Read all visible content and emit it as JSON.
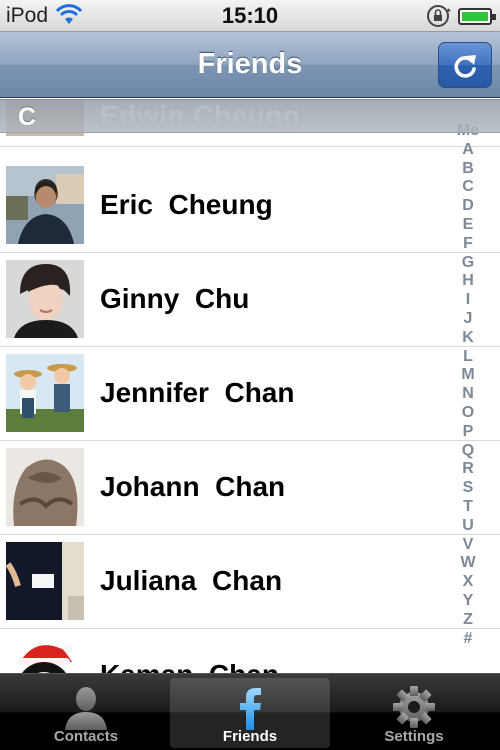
{
  "status_bar": {
    "carrier": "iPod",
    "time": "15:10",
    "icons": [
      "wifi-icon",
      "orientation-lock-icon",
      "battery-charging-icon"
    ],
    "battery_color": "#2fc53a"
  },
  "nav_bar": {
    "title": "Friends",
    "right_button_icon": "refresh-icon"
  },
  "section_header": {
    "letter": "C",
    "partial_name": "Edwin  Cheung"
  },
  "friends": [
    {
      "name": "Eric  Cheung"
    },
    {
      "name": "Ginny  Chu"
    },
    {
      "name": "Jennifer  Chan"
    },
    {
      "name": "Johann  Chan"
    },
    {
      "name": "Juliana  Chan"
    },
    {
      "name": "Kaman  Chan"
    }
  ],
  "index": [
    "Me",
    "A",
    "B",
    "C",
    "D",
    "E",
    "F",
    "G",
    "H",
    "I",
    "J",
    "K",
    "L",
    "M",
    "N",
    "O",
    "P",
    "Q",
    "R",
    "S",
    "T",
    "U",
    "V",
    "W",
    "X",
    "Y",
    "Z",
    "#"
  ],
  "tabs": [
    {
      "label": "Contacts",
      "icon": "contact-silhouette-icon",
      "selected": false
    },
    {
      "label": "Friends",
      "icon": "facebook-f-icon",
      "selected": true
    },
    {
      "label": "Settings",
      "icon": "gear-icon",
      "selected": false
    }
  ],
  "colors": {
    "nav_bar": "#7d95b3",
    "refresh_button": "#3f72c2",
    "index_text": "#7d8a96",
    "tab_bar": "#000000"
  }
}
